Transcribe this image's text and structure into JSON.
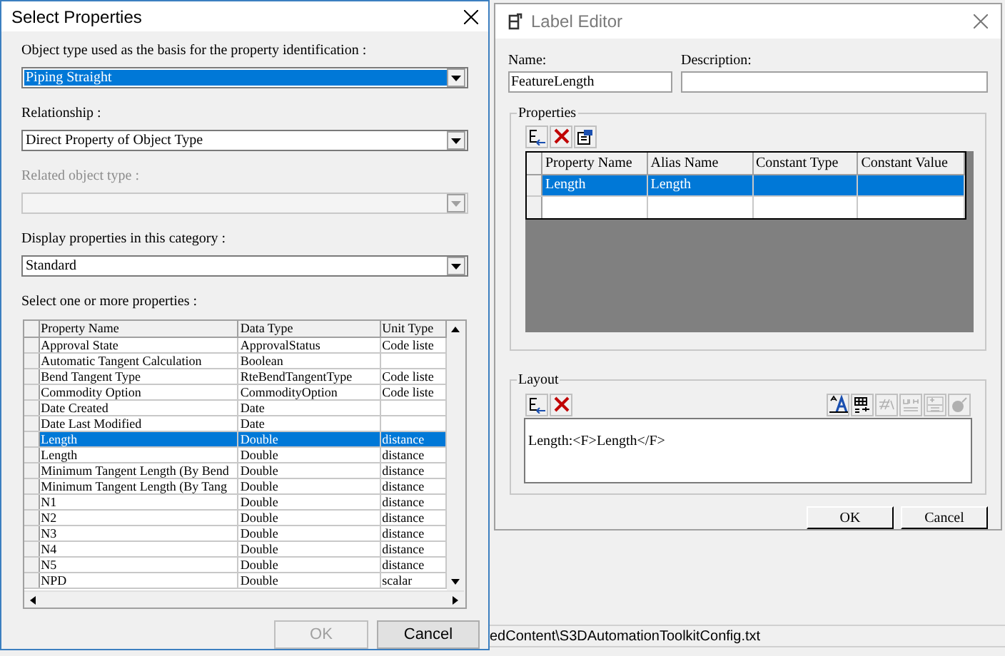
{
  "select_dialog": {
    "title": "Select Properties",
    "combos": [
      {
        "label": "Object type used as the basis for the property identification :",
        "value": "Piping Straight",
        "focused": true,
        "disabled": false
      },
      {
        "label": "Relationship :",
        "value": "Direct Property of Object Type",
        "focused": false,
        "disabled": false
      },
      {
        "label": "Related object type :",
        "focused": false,
        "disabled": true
      },
      {
        "label": "Display properties in this category :",
        "value": "Standard",
        "focused": false,
        "disabled": false
      }
    ],
    "grid_label": "Select one or more properties :",
    "columns": [
      "Property Name",
      "Data Type",
      "Unit Type"
    ],
    "rows": [
      {
        "cells": [
          "Approval State",
          "ApprovalStatus",
          "Code liste"
        ],
        "selected": false
      },
      {
        "cells": [
          "Automatic Tangent Calculation",
          "Boolean",
          ""
        ],
        "selected": false
      },
      {
        "cells": [
          "Bend Tangent Type",
          "RteBendTangentType",
          "Code liste"
        ],
        "selected": false
      },
      {
        "cells": [
          "Commodity Option",
          "CommodityOption",
          "Code liste"
        ],
        "selected": false
      },
      {
        "cells": [
          "Date Created",
          "Date",
          ""
        ],
        "selected": false
      },
      {
        "cells": [
          "Date Last Modified",
          "Date",
          ""
        ],
        "selected": false
      },
      {
        "cells": [
          "Length",
          "Double",
          "distance"
        ],
        "selected": true
      },
      {
        "cells": [
          "Length",
          "Double",
          "distance"
        ],
        "selected": false
      },
      {
        "cells": [
          "Minimum Tangent Length (By Bend",
          "Double",
          "distance"
        ],
        "selected": false
      },
      {
        "cells": [
          "Minimum Tangent Length (By Tang",
          "Double",
          "distance"
        ],
        "selected": false
      },
      {
        "cells": [
          "N1",
          "Double",
          "distance"
        ],
        "selected": false
      },
      {
        "cells": [
          "N2",
          "Double",
          "distance"
        ],
        "selected": false
      },
      {
        "cells": [
          "N3",
          "Double",
          "distance"
        ],
        "selected": false
      },
      {
        "cells": [
          "N4",
          "Double",
          "distance"
        ],
        "selected": false
      },
      {
        "cells": [
          "N5",
          "Double",
          "distance"
        ],
        "selected": false
      },
      {
        "cells": [
          "NPD",
          "Double",
          "scalar"
        ],
        "selected": false
      }
    ],
    "buttons": [
      {
        "label": "OK",
        "disabled": true
      },
      {
        "label": "Cancel",
        "disabled": false
      }
    ]
  },
  "label_editor": {
    "title": "Label Editor",
    "name_label": "Name:",
    "name_value": "FeatureLength",
    "description_label": "Description:",
    "properties_title": "Properties",
    "columns": [
      "Property Name",
      "Alias Name",
      "Constant Type",
      "Constant Value"
    ],
    "rows": [
      {
        "cells": [
          "Length",
          "Length",
          "",
          ""
        ],
        "selected": true
      },
      {
        "cells": [
          "",
          "",
          "",
          ""
        ],
        "selected": false
      }
    ],
    "layout_title": "Layout",
    "layout_tools": [
      {
        "disabled": false
      },
      {
        "disabled": false
      },
      {
        "disabled": true
      },
      {
        "disabled": true
      },
      {
        "disabled": true
      },
      {
        "disabled": true
      }
    ],
    "layout_text": "Length:<F>Length</F>",
    "buttons": [
      {
        "label": "OK"
      },
      {
        "label": "Cancel"
      }
    ]
  },
  "status_bar": {
    "text": "edContent\\S3DAutomationToolkitConfig.txt"
  }
}
